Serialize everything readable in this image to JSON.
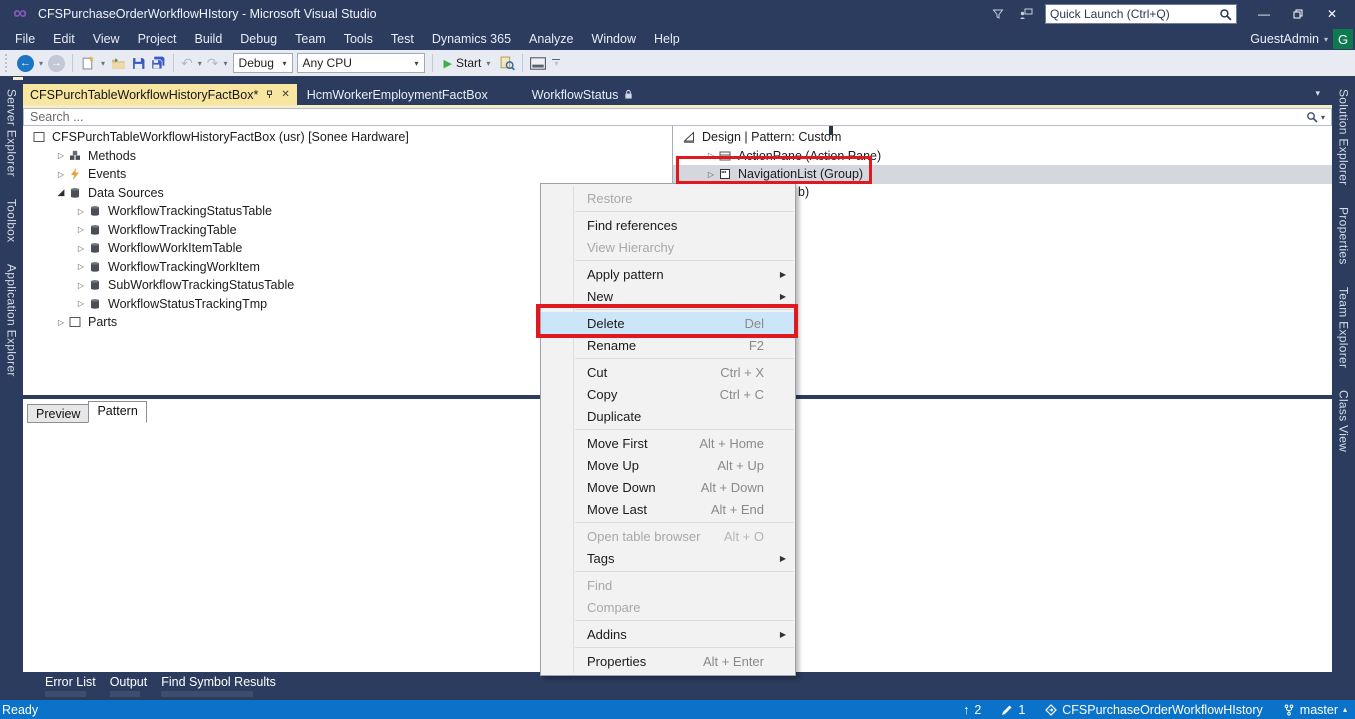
{
  "titlebar": {
    "app_title": "CFSPurchaseOrderWorkflowHIstory - Microsoft Visual Studio",
    "quick_launch_placeholder": "Quick Launch (Ctrl+Q)",
    "user_label": "GuestAdmin",
    "avatar_letter": "G"
  },
  "menubar": {
    "items": [
      "File",
      "Edit",
      "View",
      "Project",
      "Build",
      "Debug",
      "Team",
      "Tools",
      "Test",
      "Dynamics 365",
      "Analyze",
      "Window",
      "Help"
    ]
  },
  "toolbar": {
    "debug_target": "Debug",
    "platform": "Any CPU",
    "start_label": "Start"
  },
  "left_rail": {
    "tabs": [
      "Server Explorer",
      "Toolbox",
      "Application Explorer"
    ]
  },
  "right_rail": {
    "tabs": [
      "Solution Explorer",
      "Properties",
      "Team Explorer",
      "Class View"
    ]
  },
  "doc_tabs": {
    "active": "CFSPurchTableWorkflowHistoryFactBox*",
    "inactive1": "HcmWorkerEmploymentFactBox",
    "inactive2": "WorkflowStatus"
  },
  "searchbar": {
    "placeholder": "Search ..."
  },
  "left_tree": {
    "root": "CFSPurchTableWorkflowHistoryFactBox (usr) [Sonee Hardware]",
    "nodes": [
      "Methods",
      "Events",
      "Data Sources",
      "WorkflowTrackingStatusTable",
      "WorkflowTrackingTable",
      "WorkflowWorkItemTable",
      "WorkflowTrackingWorkItem",
      "SubWorkflowTrackingStatusTable",
      "WorkflowStatusTrackingTmp",
      "Parts"
    ]
  },
  "design_tree": {
    "nodes": [
      "Design | Pattern: Custom",
      "ActionPane (Action Pane)",
      "NavigationList (Group)"
    ],
    "hidden_fragment": "b)"
  },
  "context_menu": {
    "items": [
      {
        "label": "Restore"
      },
      {
        "label": "Find references"
      },
      {
        "label": "View Hierarchy"
      },
      {
        "label": "Apply pattern"
      },
      {
        "label": "New"
      },
      {
        "label": "Delete",
        "shortcut": "Del"
      },
      {
        "label": "Rename",
        "shortcut": "F2"
      },
      {
        "label": "Cut",
        "shortcut": "Ctrl + X"
      },
      {
        "label": "Copy",
        "shortcut": "Ctrl + C"
      },
      {
        "label": "Duplicate"
      },
      {
        "label": "Move First",
        "shortcut": "Alt + Home"
      },
      {
        "label": "Move Up",
        "shortcut": "Alt + Up"
      },
      {
        "label": "Move Down",
        "shortcut": "Alt + Down"
      },
      {
        "label": "Move Last",
        "shortcut": "Alt + End"
      },
      {
        "label": "Open table browser",
        "shortcut": "Alt + O"
      },
      {
        "label": "Tags"
      },
      {
        "label": "Find"
      },
      {
        "label": "Compare"
      },
      {
        "label": "Addins"
      },
      {
        "label": "Properties",
        "shortcut": "Alt + Enter"
      }
    ]
  },
  "bottom_pane": {
    "tab_preview": "Preview",
    "tab_pattern": "Pattern"
  },
  "tool_tabs": {
    "items": [
      "Error List",
      "Output",
      "Find Symbol Results"
    ]
  },
  "statusbar": {
    "ready": "Ready",
    "incoming_count": "2",
    "edits_count": "1",
    "repo_name": "CFSPurchaseOrderWorkflowHIstory",
    "branch_name": "master"
  },
  "icons": {
    "collapsed": "▷",
    "expanded": "◢",
    "caret_down": "▾",
    "caret_up": "▴",
    "close": "✕",
    "submenu": "▶",
    "up_arrow": "↑",
    "minimize": "—",
    "back_arrow": "←",
    "forward_arrow": "→",
    "undo": "↶",
    "redo": "↷",
    "play": "▶",
    "pin": "⊸",
    "vs_logo": "∞"
  },
  "colors": {
    "navy_chrome": "#2c3c5e",
    "active_tab_gold": "#f8e5a0",
    "gold_line": "#f3ecc9",
    "statusbar_blue": "#0a72c8",
    "annotation_red": "#e01820",
    "selection_gray": "#d5d7df",
    "menu_highlight_blue": "#cde6f7",
    "avatar_green": "#0e7a4f"
  }
}
